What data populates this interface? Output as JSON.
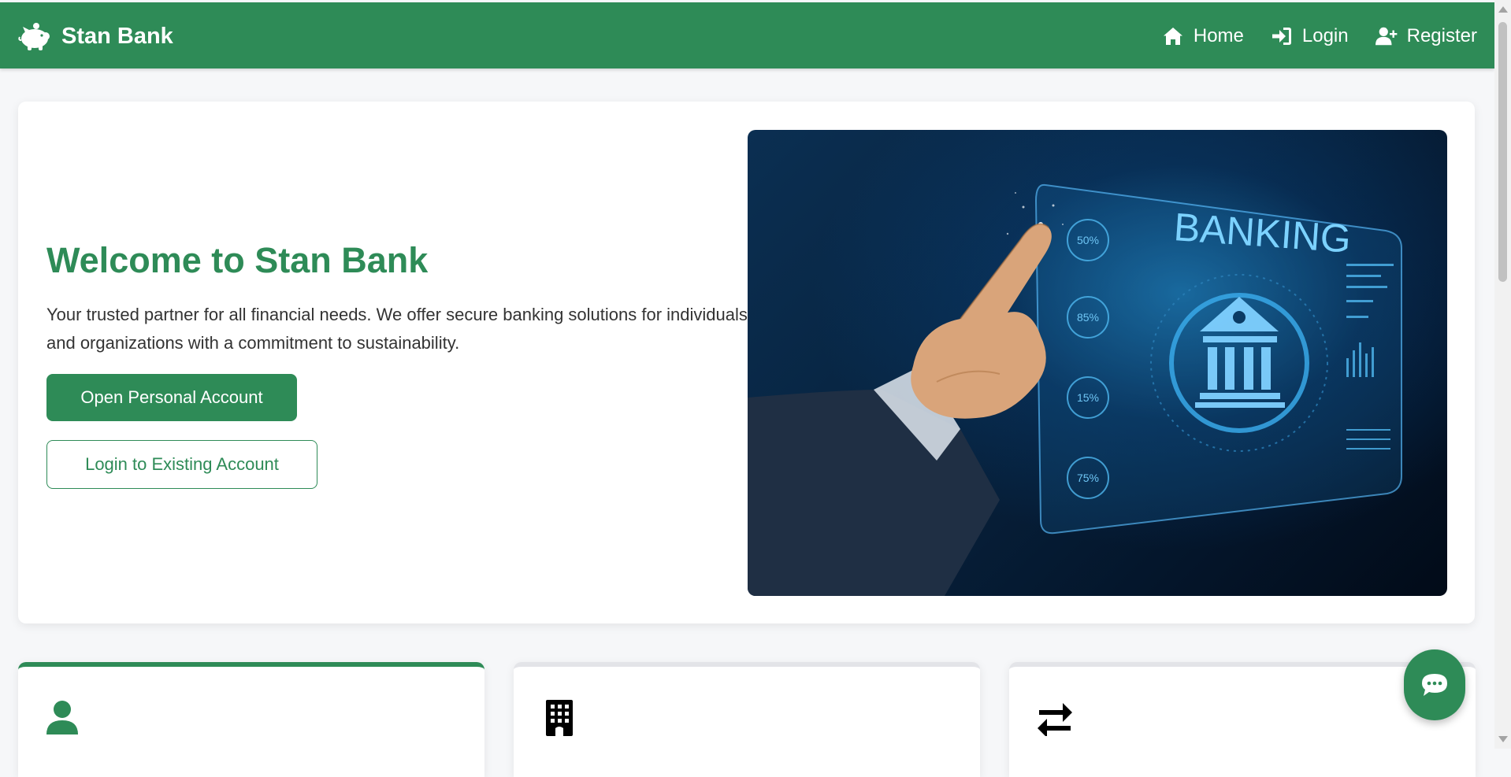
{
  "navbar": {
    "brand": "Stan Bank",
    "brand_icon": "piggy-bank-icon",
    "links": [
      {
        "label": "Home",
        "icon": "home-icon"
      },
      {
        "label": "Login",
        "icon": "sign-in-icon"
      },
      {
        "label": "Register",
        "icon": "user-plus-icon"
      }
    ]
  },
  "hero": {
    "title": "Welcome to Stan Bank",
    "description": "Your trusted partner for all financial needs. We offer secure banking solutions for individuals and organizations with a commitment to sustainability.",
    "primary_button": "Open Personal Account",
    "secondary_button": "Login to Existing Account",
    "image_text": {
      "heading": "BANKING",
      "stats": [
        "50%",
        "85%",
        "15%",
        "75%"
      ]
    }
  },
  "features": [
    {
      "icon": "user-icon",
      "active": true
    },
    {
      "icon": "building-icon",
      "active": false
    },
    {
      "icon": "exchange-arrows-icon",
      "active": false
    }
  ],
  "chat": {
    "icon": "chat-bubble-icon"
  },
  "colors": {
    "brand_green": "#2e8b57",
    "page_background": "#f6f7f9",
    "card_background": "#ffffff"
  }
}
